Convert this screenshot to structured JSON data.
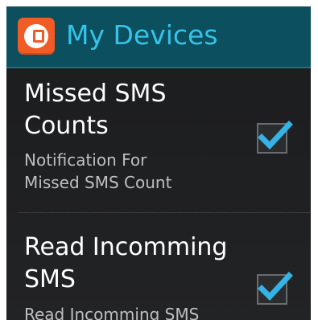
{
  "action_bar": {
    "title": "My Devices",
    "icon": "app-logo-icon",
    "accent_color": "#35c3e8"
  },
  "preferences": [
    {
      "title_line1": "Missed SMS",
      "title_line2": "Counts",
      "summary_line1": "Notification For",
      "summary_line2": "Missed SMS Count",
      "checked": true
    },
    {
      "title_line1": "Read Incomming",
      "title_line2": "SMS",
      "summary_line1": "Read Incomming SMS",
      "checked": true
    }
  ],
  "colors": {
    "action_bar_bg": "#0c4f5f",
    "checkmark": "#35b3e6",
    "app_icon_bg": "#f15b25"
  }
}
